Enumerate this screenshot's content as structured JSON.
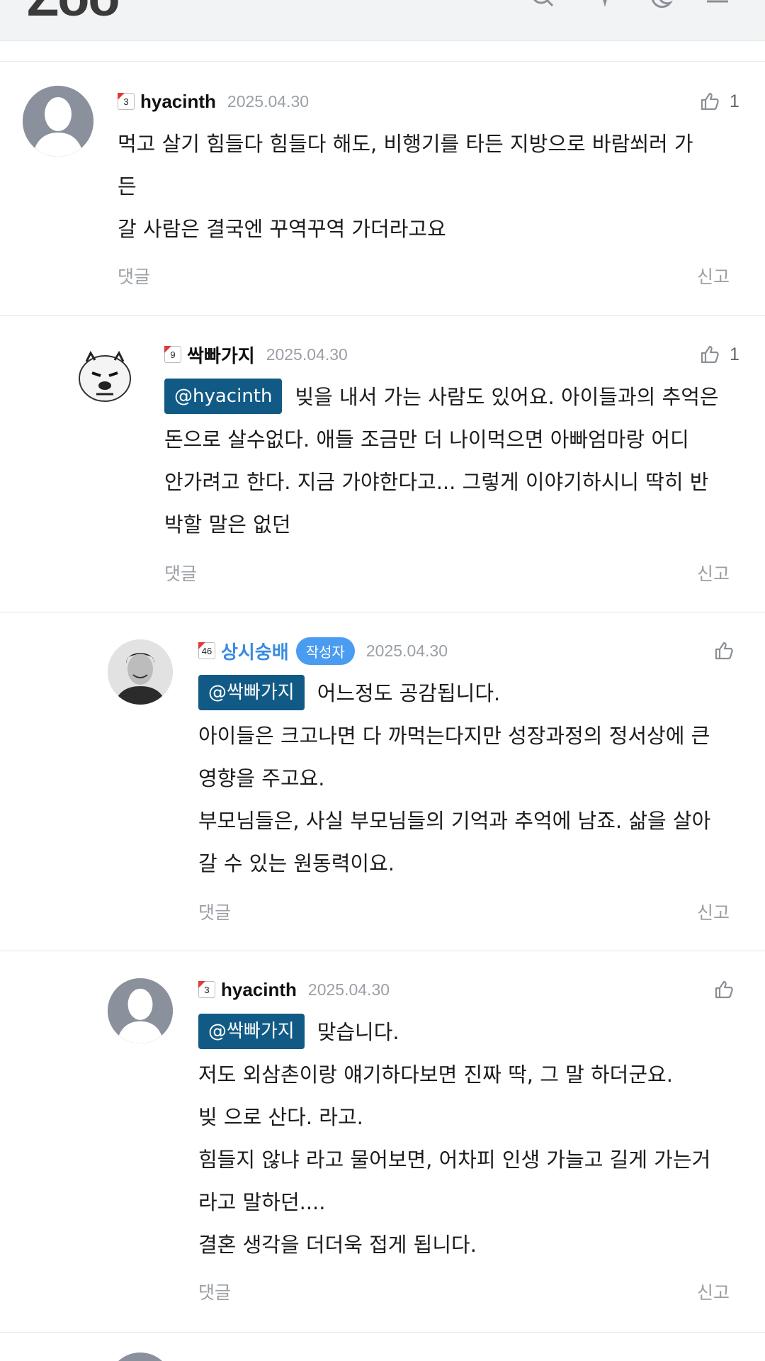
{
  "header": {
    "logo": "Zoo",
    "icons": [
      "search-icon",
      "sparkle-icon",
      "moon-icon",
      "menu-icon"
    ]
  },
  "comments": [
    {
      "level": "3",
      "name": "hyacinth",
      "is_author": false,
      "date": "2025.04.30",
      "likes": "1",
      "mention": "",
      "lines": [
        "먹고 살기 힘들다 힘들다 해도, 비행기를 타든 지방으로 바람쐬러 가",
        "든",
        "갈 사람은 결국엔 꾸역꾸역 가더라고요"
      ],
      "reply_label": "댓글",
      "report_label": "신고"
    },
    {
      "level": "9",
      "name": "싹빠가지",
      "is_author": false,
      "date": "2025.04.30",
      "likes": "1",
      "mention": "@hyacinth",
      "lines": [
        "빚을 내서 가는 사람도 있어요. 아이들과의 추억은",
        "돈으로 살수없다. 애들 조금만 더 나이먹으면 아빠엄마랑 어디",
        "안가려고 한다. 지금 가야한다고... 그렇게 이야기하시니 딱히 반",
        "박할 말은 없던"
      ],
      "reply_label": "댓글",
      "report_label": "신고"
    },
    {
      "level": "46",
      "name": "상시숭배",
      "is_author": true,
      "author_badge": "작성자",
      "date": "2025.04.30",
      "likes": "",
      "mention": "@싹빠가지",
      "lines": [
        "어느정도 공감됩니다.",
        "아이들은 크고나면 다 까먹는다지만 성장과정의 정서상에 큰",
        "영향을 주고요.",
        "부모님들은, 사실 부모님들의 기억과 추억에 남죠. 삶을 살아",
        "갈 수 있는 원동력이요."
      ],
      "reply_label": "댓글",
      "report_label": "신고"
    },
    {
      "level": "3",
      "name": "hyacinth",
      "is_author": false,
      "date": "2025.04.30",
      "likes": "",
      "mention": "@싹빠가지",
      "lines": [
        "맞습니다.",
        "저도 외삼촌이랑 얘기하다보면 진짜 딱, 그 말 하더군요.",
        "빚 으로 산다. 라고.",
        "힘들지 않냐 라고 물어보면, 어차피 인생 가늘고 길게 가는거",
        "라고 말하던....",
        "결혼 생각을 더더욱 접게 됩니다."
      ],
      "reply_label": "댓글",
      "report_label": "신고"
    }
  ]
}
